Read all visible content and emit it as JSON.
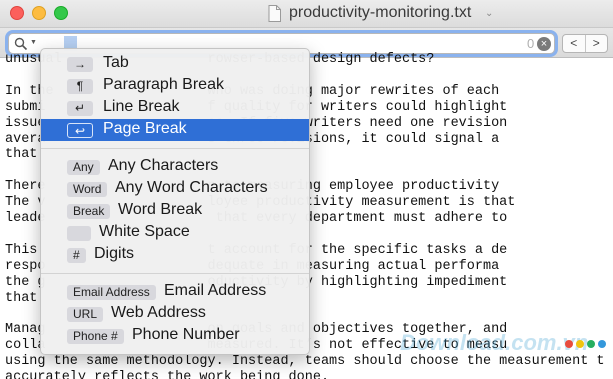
{
  "window": {
    "title": "productivity-monitoring.txt"
  },
  "find": {
    "match_count": "0",
    "clear_glyph": "×",
    "prev_glyph": "<",
    "next_glyph": ">"
  },
  "icons": {
    "search": "magnifier-icon",
    "document": "text-document-icon",
    "title_menu": "chevron-down-icon"
  },
  "colors": {
    "selection": "#2f6fd6",
    "focus_ring": "#8ab2ee",
    "close": "#fc605c",
    "minimize": "#fdbc40",
    "zoom": "#34c84a"
  },
  "document_lines": [
    "unusual                  rowser-based design defects?",
    "",
    "In the                   who was doing major rewrites of each",
    "submi                    f quality for writers could highlight",
    "issue                    ce. If five writers need one revision",
    "avera                    s three revisions, it could signal a",
    "that",
    "",
    "There                    n to measuring employee productivity",
    "The v                    loyee productivity measurement is that",
    "leade                     that every department must adhere to",
    "",
    "This                     t account for the specific tasks a de",
    "respo                    dequate in measuring actual performa",
    "the g                    oductivity by highlighting impediment",
    "that",
    "",
    "Manag                    on goals and objectives together, and",
    "colla                    measured. It’s not effective to measu",
    "using the same methodology. Instead, teams should choose the measurement t",
    "accurately reflects the work being done."
  ],
  "watermark": "Download.com.vn",
  "menu": {
    "group1": [
      {
        "token": "→",
        "label": "Tab"
      },
      {
        "token": "¶",
        "label": "Paragraph Break"
      },
      {
        "token": "↵",
        "label": "Line Break"
      },
      {
        "token": "↩",
        "label": "Page Break"
      }
    ],
    "group2": [
      {
        "token": "Any",
        "label": "Any Characters"
      },
      {
        "token": "Word",
        "label": "Any Word Characters"
      },
      {
        "token": "Break",
        "label": "Word Break"
      },
      {
        "token": "",
        "label": "White Space"
      },
      {
        "token": "#",
        "label": "Digits"
      }
    ],
    "group3": [
      {
        "token": "Email Address",
        "label": "Email Address"
      },
      {
        "token": "URL",
        "label": "Web Address"
      },
      {
        "token": "Phone #",
        "label": "Phone Number"
      }
    ],
    "selected_item": "Page Break"
  }
}
